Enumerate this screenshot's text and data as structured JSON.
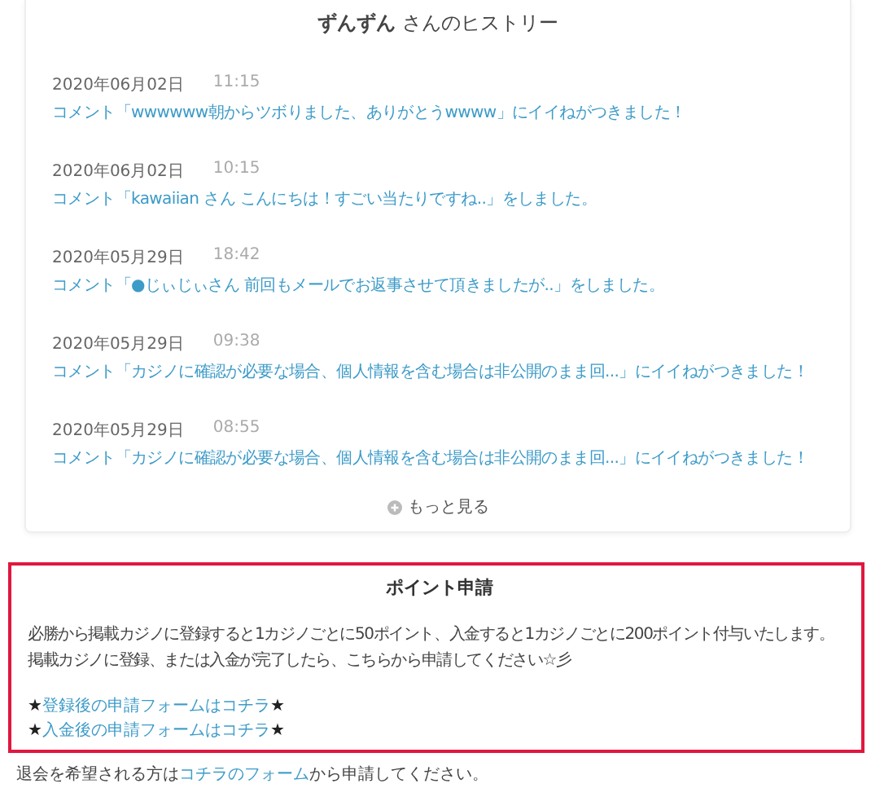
{
  "history": {
    "title": "**ずんずん** さんのヒストリー",
    "entries": [
      {
        "date": "2020年06月02日",
        "time": "11:15",
        "text": "コメント「wwwwww朝からツボりました、ありがとうwwww」にイイねがつきました！"
      },
      {
        "date": "2020年06月02日",
        "time": "10:15",
        "text": "コメント「kawaiian さん こんにちは！すごい当たりですね..」をしました。"
      },
      {
        "date": "2020年05月29日",
        "time": "18:42",
        "text": "コメント「●じぃじぃさん 前回もメールでお返事させて頂きましたが..」をしました。"
      },
      {
        "date": "2020年05月29日",
        "time": "09:38",
        "text": "コメント「カジノに確認が必要な場合、個人情報を含む場合は非公開のまま回...」にイイねがつきました！"
      },
      {
        "date": "2020年05月29日",
        "time": "08:55",
        "text": "コメント「カジノに確認が必要な場合、個人情報を含む場合は非公開のまま回...」にイイねがつきました！"
      }
    ],
    "more": "もっと見る"
  },
  "points": {
    "title": "ポイント申請",
    "paragraphs": [
      "必勝から掲載カジノに登録すると1カジノごとに50ポイント、入金すると1カジノごとに200ポイント付与いたします。",
      "掲載カジノに登録、または入金が完了したら、こちらから申請してください☆彡"
    ],
    "links": [
      {
        "before": "★",
        "link": "登録後の申請フォームはコチラ",
        "after": "★"
      },
      {
        "before": "★",
        "link": "入金後の申請フォームはコチラ",
        "after": "★"
      }
    ]
  },
  "footer": {
    "before": "退会を希望される方は",
    "link": "コチラのフォーム",
    "after": "から申請してください。"
  }
}
